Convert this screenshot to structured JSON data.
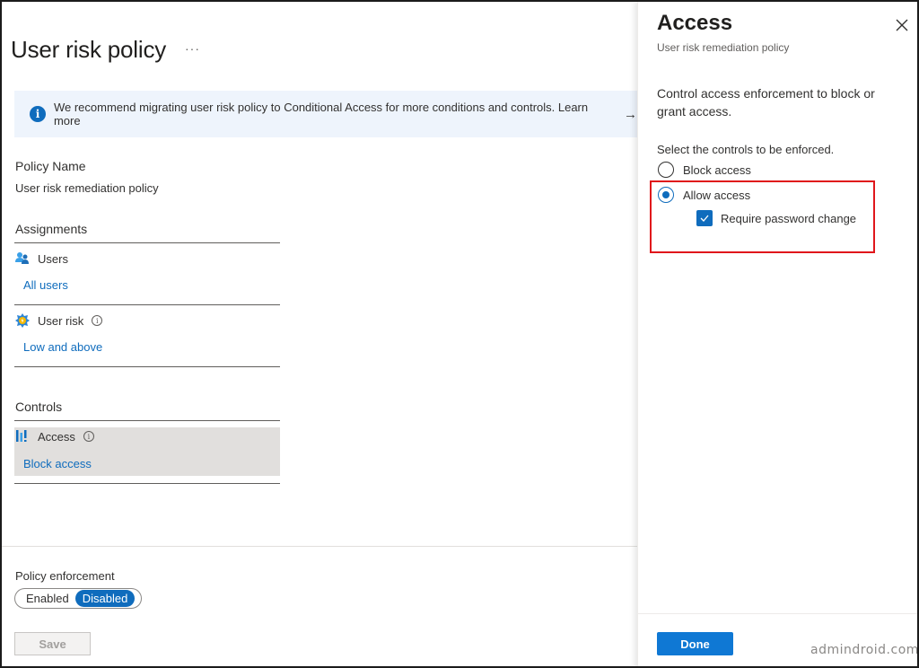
{
  "page": {
    "title": "User risk policy",
    "more_label": "···"
  },
  "banner": {
    "icon": "info-icon",
    "text": "We recommend migrating user risk policy to Conditional Access for more conditions and controls. Learn more",
    "arrow": "→"
  },
  "policy_name": {
    "label": "Policy Name",
    "value": "User risk remediation policy"
  },
  "assignments": {
    "heading": "Assignments",
    "items": [
      {
        "icon": "users-icon",
        "title": "Users",
        "link": "All users",
        "has_info": false
      },
      {
        "icon": "user-risk-icon",
        "title": "User risk",
        "link": "Low and above",
        "has_info": true
      }
    ]
  },
  "controls": {
    "heading": "Controls",
    "items": [
      {
        "icon": "access-icon",
        "title": "Access",
        "link": "Block access",
        "has_info": true
      }
    ]
  },
  "info_glyph": "i",
  "enforcement": {
    "label": "Policy enforcement",
    "options": [
      "Enabled",
      "Disabled"
    ],
    "selected": "Disabled"
  },
  "save_label": "Save",
  "panel": {
    "title": "Access",
    "subtitle": "User risk remediation policy",
    "description": "Control access enforcement to block or grant access.",
    "select_prompt": "Select the controls to be enforced.",
    "radio_options": [
      {
        "label": "Block access",
        "checked": false
      },
      {
        "label": "Allow access",
        "checked": true
      }
    ],
    "checkbox": {
      "label": "Require password change",
      "checked": true
    },
    "done_label": "Done",
    "highlight_color": "#e0161b"
  },
  "watermark": "admindroid.com",
  "colors": {
    "accent": "#0f6cbd",
    "banner_bg": "#eef4fc",
    "selected_row_bg": "#e1dfdd"
  }
}
